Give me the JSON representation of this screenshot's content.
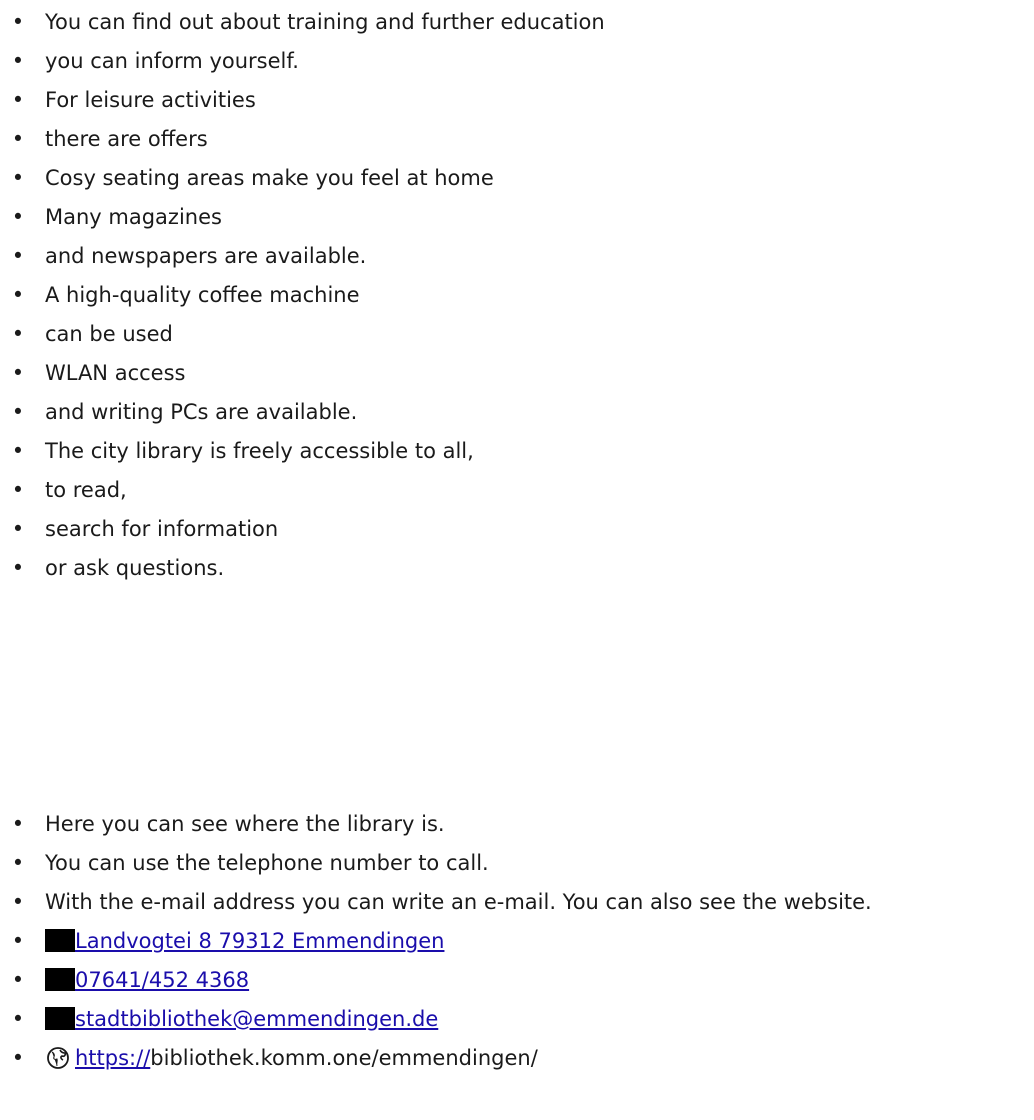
{
  "info_items": [
    "You can find out about training and further education",
    "you can inform yourself.",
    "For leisure activities",
    "there are offers",
    "Cosy seating areas make you feel at home",
    "Many magazines",
    "and newspapers are available.",
    "A high-quality coffee machine",
    "can be used",
    "WLAN access",
    "and writing PCs are available.",
    "The city library is freely accessible to all,",
    "to read,",
    "search for information",
    "or ask questions."
  ],
  "contact_intro": [
    "Here you can see where the library is.",
    "You can use the telephone number to call.",
    "With the e-mail address you can write an e-mail. You can also see the website."
  ],
  "contact": {
    "address": "Landvogtei 8 79312 Emmendingen",
    "phone": "07641/452 4368",
    "email": "stadtbibliothek@emmendingen.de",
    "website_link": "https://",
    "website_rest": "bibliothek.komm.one/emmendingen/"
  },
  "icons": {
    "address": "location-icon",
    "phone": "phone-icon",
    "email": "mail-icon",
    "website": "globe-icon"
  },
  "bullet": "•",
  "colors": {
    "text": "#1a1a1a",
    "link": "#1a0dab",
    "icon_block": "#000000"
  }
}
